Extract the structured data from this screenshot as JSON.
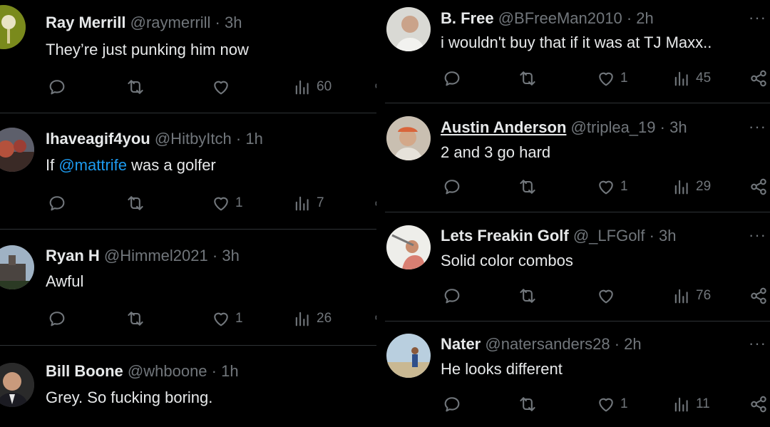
{
  "left_posts": [
    {
      "name": "Ray Merrill",
      "handle": "@raymerrill",
      "sep": "·",
      "time": "3h",
      "text": "They’re just punking him now",
      "replies": "",
      "reposts": "",
      "likes": "",
      "views": "60",
      "avatar": "golf-ball-on-tee"
    },
    {
      "name": "Ihaveagif4you",
      "handle": "@HitbyItch",
      "sep": "·",
      "time": "1h",
      "text_before": "If ",
      "mention": "@mattrife",
      "text_after": " was a golfer",
      "replies": "",
      "reposts": "",
      "likes": "1",
      "views": "7",
      "avatar": "sunset-trees"
    },
    {
      "name": "Ryan H",
      "handle": "@Himmel2021",
      "sep": "·",
      "time": "3h",
      "text": "Awful",
      "replies": "",
      "reposts": "",
      "likes": "1",
      "views": "26",
      "avatar": "building-sky"
    },
    {
      "name": "Bill Boone",
      "handle": "@whboone",
      "sep": "·",
      "time": "1h",
      "text": "Grey. So fucking boring.",
      "avatar": "man-in-suit"
    }
  ],
  "right_posts": [
    {
      "name": "B. Free",
      "handle": "@BFreeMan2010",
      "sep": "·",
      "time": "2h",
      "text": "i wouldn't buy that if it was at TJ Maxx..",
      "replies": "",
      "reposts": "",
      "likes": "1",
      "views": "45",
      "avatar": "man-white-shirt"
    },
    {
      "name": "Austin Anderson",
      "handle": "@triplea_19",
      "sep": "·",
      "time": "3h",
      "text": "2 and 3 go hard",
      "replies": "",
      "reposts": "",
      "likes": "1",
      "views": "29",
      "avatar": "man-orange-cap"
    },
    {
      "name": "Lets Freakin Golf",
      "handle": "@_LFGolf",
      "sep": "·",
      "time": "3h",
      "text": "Solid color combos",
      "replies": "",
      "reposts": "",
      "likes": "",
      "views": "76",
      "avatar": "golfer-swing"
    },
    {
      "name": "Nater",
      "handle": "@natersanders28",
      "sep": "·",
      "time": "2h",
      "text": "He looks different",
      "replies": "",
      "reposts": "",
      "likes": "1",
      "views": "11",
      "avatar": "golfer-beach"
    }
  ],
  "more_label": "···",
  "edge_marks": {
    "dot": "·",
    "share_partial": "ɑ"
  },
  "colors": {
    "background": "#000000",
    "text": "#e7e9ea",
    "muted": "#71767b",
    "link": "#1d9bf0",
    "divider": "#2f3336"
  },
  "icons": [
    "reply-icon",
    "repost-icon",
    "like-icon",
    "views-icon",
    "share-icon",
    "more-icon"
  ]
}
